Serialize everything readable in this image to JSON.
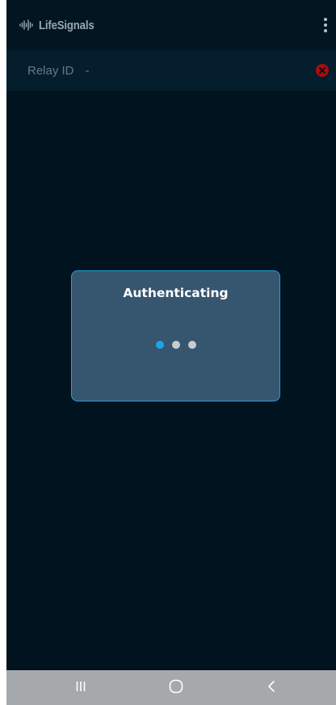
{
  "app": {
    "brand": "LifeSignals"
  },
  "relay": {
    "label": "Relay ID",
    "value": "-",
    "status_color": "#a50d12"
  },
  "modal": {
    "title": "Authenticating"
  },
  "loader": {
    "dots": [
      {
        "color": "#1aa6e6",
        "active": true
      },
      {
        "color": "#c8ccd0",
        "active": false
      },
      {
        "color": "#c8ccd0",
        "active": false
      }
    ]
  },
  "colors": {
    "background": "#01131f",
    "accent": "#1ea3d8",
    "modal": "#36556f",
    "nav_bar": "#a5a9ac"
  },
  "icons": {
    "brand": "waveform-icon",
    "menu": "more-vert-icon",
    "relay_status": "error-circle-icon",
    "nav": [
      "recent-apps-icon",
      "home-icon",
      "back-icon"
    ]
  }
}
